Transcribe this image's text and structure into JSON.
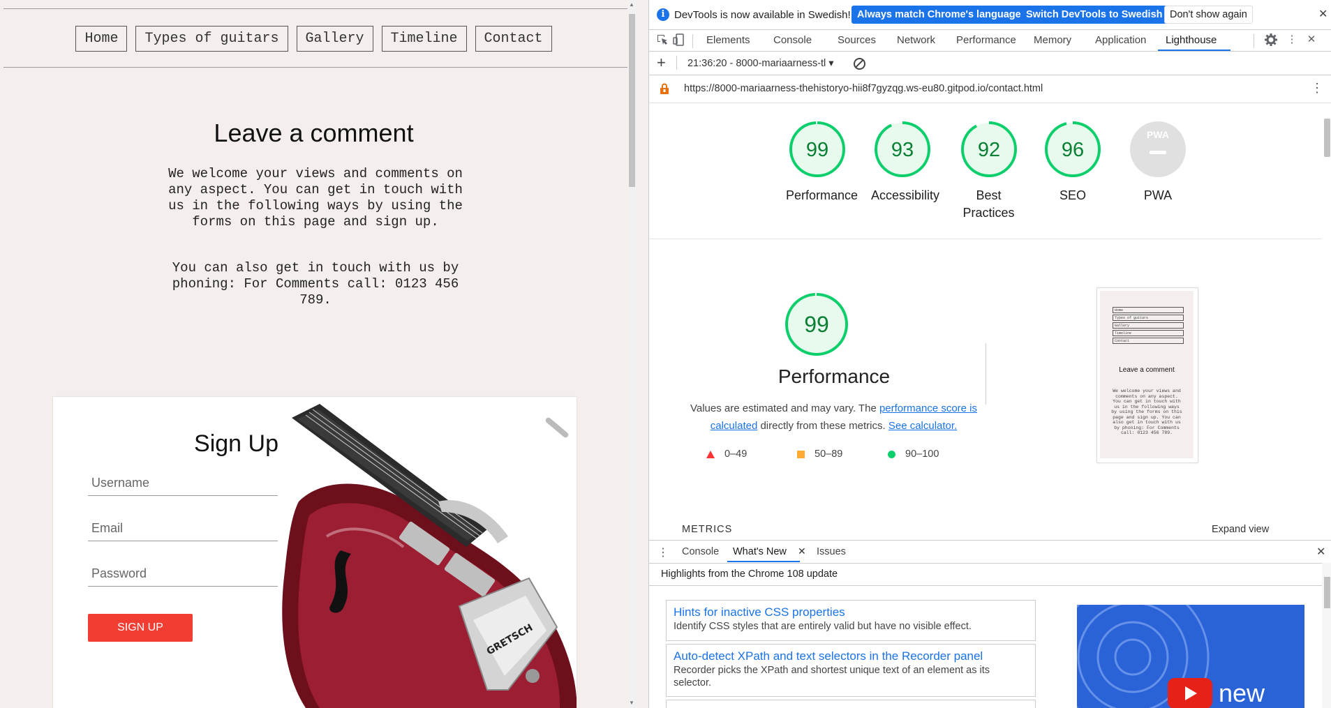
{
  "site": {
    "nav": [
      "Home",
      "Types of guitars",
      "Gallery",
      "Timeline",
      "Contact"
    ],
    "comment_title": "Leave a comment",
    "comment_p1": "We welcome your views and comments on any aspect. You can get in touch with us in the following ways by using the forms on this page and sign up.",
    "comment_p2": "You can also get in touch with us by phoning: For Comments call: 0123 456 789.",
    "signup": {
      "title": "Sign Up",
      "username_placeholder": "Username",
      "email_placeholder": "Email",
      "password_placeholder": "Password",
      "button_label": "SIGN UP",
      "button_color": "#f23d33"
    }
  },
  "devtools": {
    "infobar": {
      "text": "DevTools is now available in Swedish!",
      "match_button": "Always match Chrome's language",
      "switch_button": "Switch DevTools to Swedish",
      "dont_show_button": "Don't show again"
    },
    "tabs": [
      "Elements",
      "Console",
      "Sources",
      "Network",
      "Performance",
      "Memory",
      "Application",
      "Lighthouse"
    ],
    "active_tab": "Lighthouse",
    "lighthouse_toolbar": {
      "report_select": "21:36:20 - 8000-mariaarness-tl"
    },
    "url": "https://8000-mariaarness-thehistoryo-hii8f7gyzqg.ws-eu80.gitpod.io/contact.html",
    "scores": [
      {
        "label": "Performance",
        "score": "99"
      },
      {
        "label": "Accessibility",
        "score": "93"
      },
      {
        "label": "Best Practices",
        "score": "92"
      },
      {
        "label": "SEO",
        "score": "96"
      },
      {
        "label": "PWA",
        "score": ""
      }
    ],
    "pwa_badge": "PWA",
    "score_color": "#0cce6b",
    "performance": {
      "score": "99",
      "title": "Performance",
      "desc_prefix": "Values are estimated and may vary. The ",
      "desc_link1": "performance score is calculated",
      "desc_middle": " directly from these metrics. ",
      "desc_link2": "See calculator.",
      "legend": [
        {
          "range": "0–49",
          "color": "#ff3333"
        },
        {
          "range": "50–89",
          "color": "#ffaa33"
        },
        {
          "range": "90–100",
          "color": "#0cce6b"
        }
      ]
    },
    "thumbnail": {
      "nav": [
        "Home",
        "Types of guitars",
        "Gallery",
        "Timeline",
        "Contact"
      ],
      "title": "Leave a comment",
      "text": "We welcome your views and comments on any aspect. You can get in touch with us in the following ways by using the forms on this page and sign up. You can also get in touch with us by phoning: For Comments call: 0123 456 789."
    },
    "metrics_label": "METRICS",
    "expand_view": "Expand view",
    "drawer": {
      "tabs": [
        "Console",
        "What's New",
        "Issues"
      ],
      "active_tab": "What's New",
      "heading": "Highlights from the Chrome 108 update",
      "items": [
        {
          "title": "Hints for inactive CSS properties",
          "desc": "Identify CSS styles that are entirely valid but have no visible effect."
        },
        {
          "title": "Auto-detect XPath and text selectors in the Recorder panel",
          "desc": "Recorder picks the XPath and shortest unique text of an element as its selector."
        }
      ],
      "video_label": "new"
    }
  }
}
